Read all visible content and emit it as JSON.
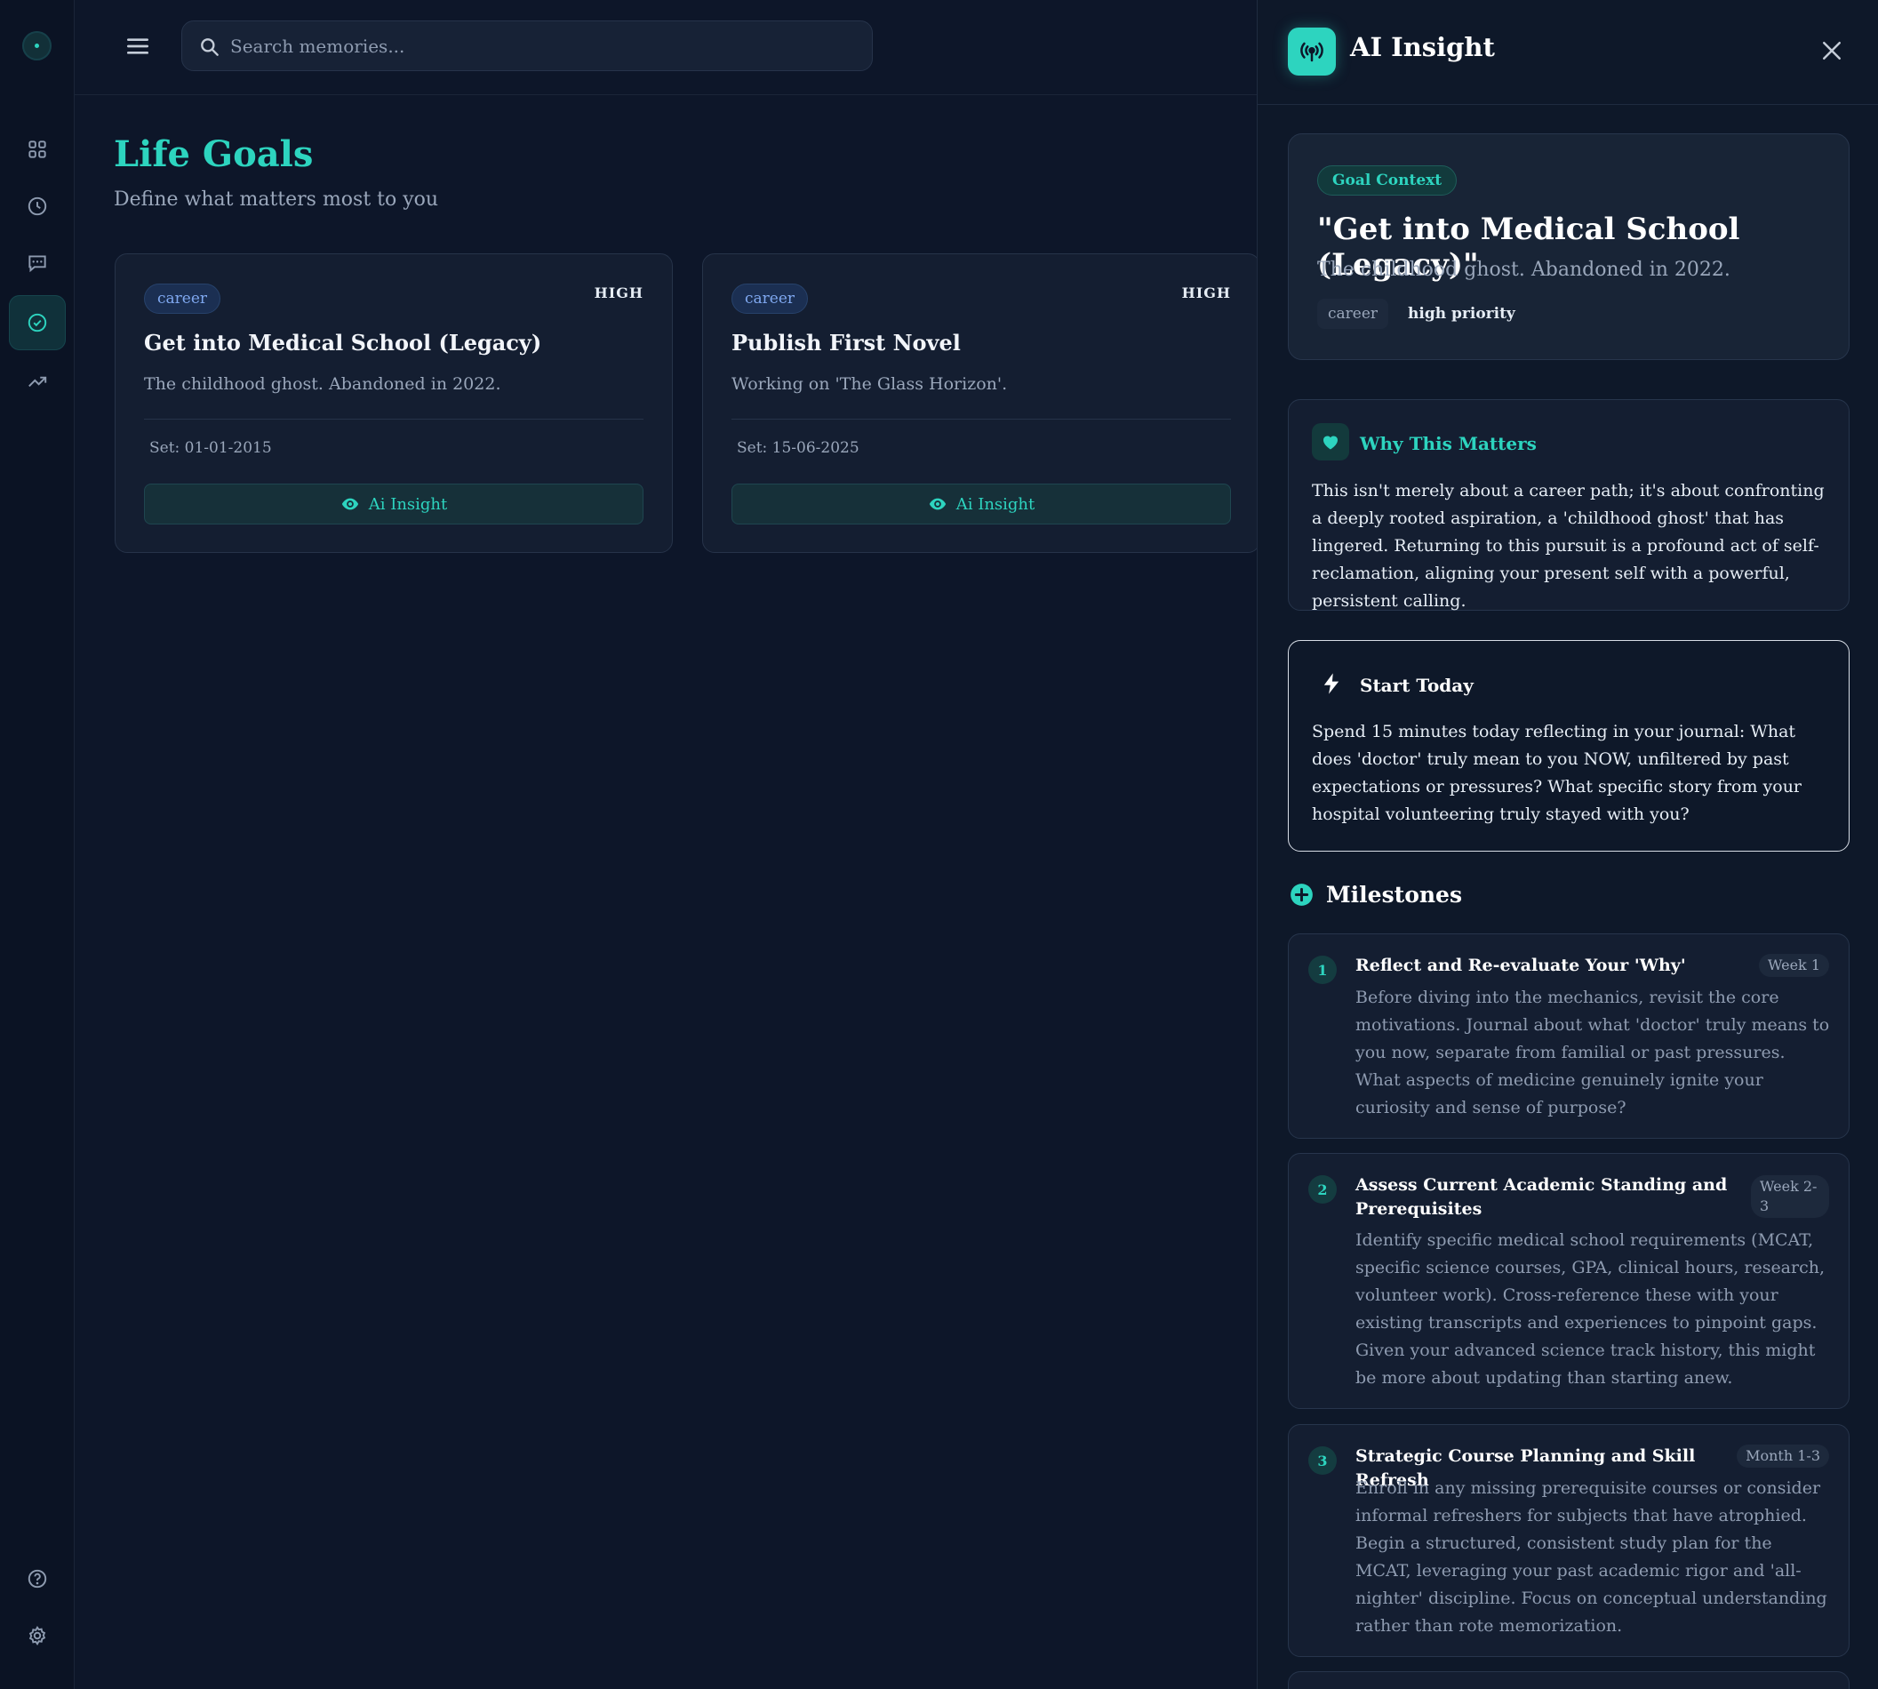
{
  "search": {
    "placeholder": "Search memories..."
  },
  "page": {
    "title": "Life Goals",
    "subtitle": "Define what matters most to you"
  },
  "goals": [
    {
      "category": "career",
      "priority": "HIGH",
      "title": "Get into Medical School (Legacy)",
      "description": "The childhood ghost. Abandoned in 2022.",
      "date": "Set: 01-01-2015",
      "button": "Ai Insight"
    },
    {
      "category": "career",
      "priority": "HIGH",
      "title": "Publish First Novel",
      "description": "Working on 'The Glass Horizon'.",
      "date": "Set: 15-06-2025",
      "button": "Ai Insight"
    }
  ],
  "panel": {
    "title": "AI Insight",
    "context": {
      "badge": "Goal Context",
      "title": "\"Get into Medical School (Legacy)\"",
      "description": "The childhood ghost. Abandoned in 2022.",
      "category": "career",
      "priority": "high priority"
    },
    "why": {
      "title": "Why This Matters",
      "body": "This isn't merely about a career path; it's about confronting a deeply rooted aspiration, a 'childhood ghost' that has lingered. Returning to this pursuit is a profound act of self-reclamation, aligning your present self with a powerful, persistent calling."
    },
    "start": {
      "title": "Start Today",
      "body": "Spend 15 minutes today reflecting in your journal: What does 'doctor' truly mean to you NOW, unfiltered by past expectations or pressures? What specific story from your hospital volunteering truly stayed with you?"
    },
    "milestones_title": "Milestones",
    "milestones": [
      {
        "number": "1",
        "title": "Reflect and Re-evaluate Your 'Why'",
        "timeframe": "Week 1",
        "description": "Before diving into the mechanics, revisit the core motivations. Journal about what 'doctor' truly means to you now, separate from familial or past pressures. What aspects of medicine genuinely ignite your curiosity and sense of purpose?"
      },
      {
        "number": "2",
        "title": "Assess Current Academic Standing and Prerequisites",
        "timeframe": "Week 2-3",
        "description": "Identify specific medical school requirements (MCAT, specific science courses, GPA, clinical hours, research, volunteer work). Cross-reference these with your existing transcripts and experiences to pinpoint gaps. Given your advanced science track history, this might be more about updating than starting anew."
      },
      {
        "number": "3",
        "title": "Strategic Course Planning and Skill Refresh",
        "timeframe": "Month 1-3",
        "description": "Enroll in any missing prerequisite courses or consider informal refreshers for subjects that have atrophied. Begin a structured, consistent study plan for the MCAT, leveraging your past academic rigor and 'all-nighter' discipline. Focus on conceptual understanding rather than rote memorization."
      }
    ]
  },
  "colors": {
    "accent": "#2dd4bf",
    "background": "#0d1629",
    "card": "#141e31",
    "tag_blue": "#7fa8f0"
  },
  "icons": {
    "rail": [
      "app-logo",
      "dashboard-icon",
      "history-icon",
      "chat-icon",
      "goals-icon",
      "trends-icon",
      "help-icon",
      "settings-icon"
    ],
    "panel": [
      "broadcast-icon",
      "close-icon",
      "heart-icon",
      "lightning-icon",
      "plus-circle-icon",
      "eye-icon"
    ]
  }
}
